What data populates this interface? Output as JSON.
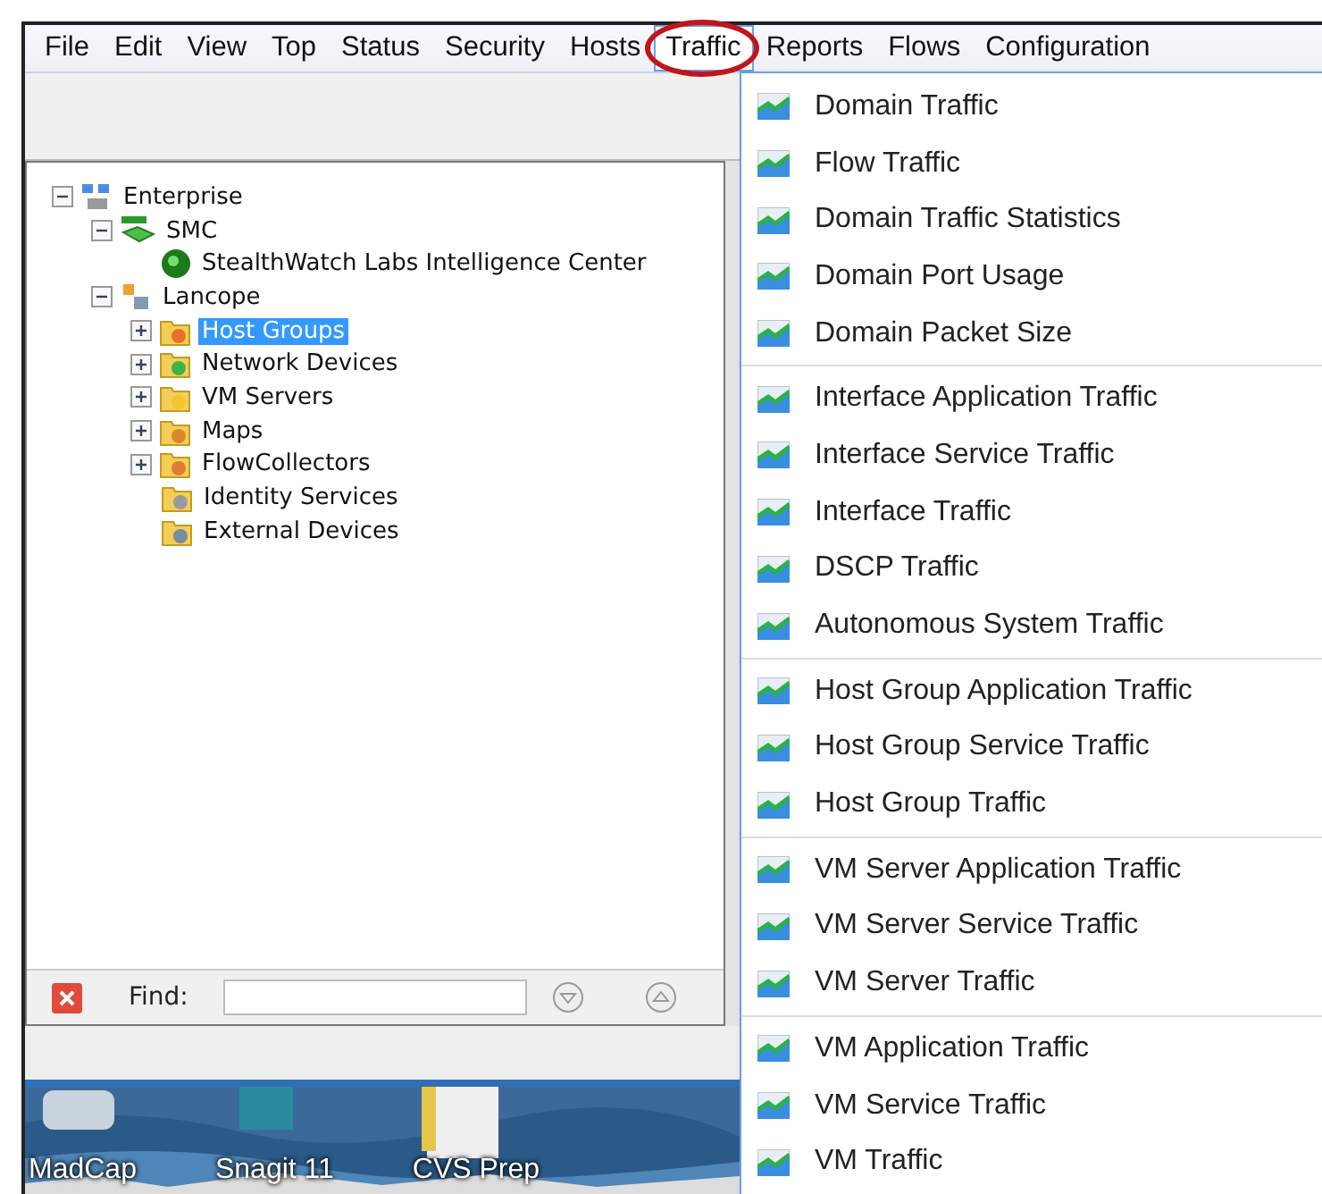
{
  "menu_bar": [
    {
      "label": "File",
      "selected": false
    },
    {
      "label": "Edit",
      "selected": false
    },
    {
      "label": "View",
      "selected": false
    },
    {
      "label": "Top",
      "selected": false
    },
    {
      "label": "Status",
      "selected": false
    },
    {
      "label": "Security",
      "selected": false
    },
    {
      "label": "Hosts",
      "selected": false
    },
    {
      "label": "Traffic",
      "selected": true
    },
    {
      "label": "Reports",
      "selected": false
    },
    {
      "label": "Flows",
      "selected": false
    },
    {
      "label": "Configuration",
      "selected": false
    }
  ],
  "tree": [
    {
      "label": "Enterprise",
      "kind": "enterprise",
      "selected": false,
      "expanded": true,
      "children": [
        {
          "label": "SMC",
          "kind": "smc",
          "selected": false,
          "expanded": true,
          "children": [
            {
              "label": "StealthWatch Labs Intelligence Center",
              "kind": "globe",
              "selected": false
            }
          ]
        },
        {
          "label": "Lancope",
          "kind": "site",
          "selected": false,
          "expanded": true,
          "children": [
            {
              "label": "Host Groups",
              "kind": "folder",
              "color": "#e8702a",
              "selected": true,
              "expanded": false
            },
            {
              "label": "Network Devices",
              "kind": "folder",
              "color": "#3cb44a",
              "selected": false,
              "expanded": false
            },
            {
              "label": "VM Servers",
              "kind": "folder",
              "color": "#f2c531",
              "selected": false,
              "expanded": false
            },
            {
              "label": "Maps",
              "kind": "folder",
              "color": "#d9892b",
              "selected": false,
              "expanded": false
            },
            {
              "label": "FlowCollectors",
              "kind": "folder",
              "color": "#e07a3a",
              "selected": false,
              "expanded": false
            },
            {
              "label": "Identity Services",
              "kind": "folder",
              "color": "#9a9a9a",
              "selected": false
            },
            {
              "label": "External Devices",
              "kind": "folder",
              "color": "#7a8aa0",
              "selected": false
            }
          ]
        }
      ]
    }
  ],
  "find_bar": {
    "label": "Find:"
  },
  "desktop_icons": [
    "MadCap",
    "Snagit 11",
    "CVS Prep"
  ],
  "traffic_menu": [
    [
      "Domain Traffic",
      "Flow Traffic",
      "Domain Traffic Statistics",
      "Domain Port Usage",
      "Domain Packet Size"
    ],
    [
      "Interface Application Traffic",
      "Interface Service Traffic",
      "Interface Traffic",
      "DSCP Traffic",
      "Autonomous System Traffic"
    ],
    [
      "Host Group Application Traffic",
      "Host Group Service Traffic",
      "Host Group Traffic"
    ],
    [
      "VM Server Application Traffic",
      "VM Server Service Traffic",
      "VM Server Traffic"
    ],
    [
      "VM Application Traffic",
      "VM Service Traffic",
      "VM Traffic"
    ]
  ]
}
